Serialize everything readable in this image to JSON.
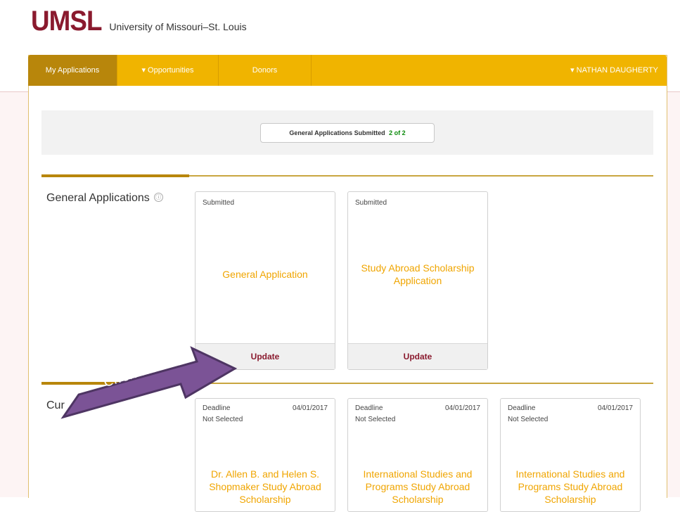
{
  "logo": {
    "mark": "UMSL",
    "text": "University of Missouri–St. Louis"
  },
  "nav": {
    "items": [
      {
        "label": "My Applications"
      },
      {
        "label": "▾ Opportunities"
      },
      {
        "label": "Donors"
      }
    ],
    "user": "▾ NATHAN DAUGHERTY"
  },
  "summary": {
    "label": "General Applications Submitted",
    "count": "2 of 2"
  },
  "general": {
    "title": "General Applications",
    "info_icon": "ⓘ",
    "cards": [
      {
        "status": "Submitted",
        "title": "General Application",
        "action": "Update"
      },
      {
        "status": "Submitted",
        "title": "Study Abroad Scholarship Application",
        "action": "Update"
      }
    ]
  },
  "current": {
    "title_partial": "Cur",
    "cards": [
      {
        "deadline_label": "Deadline",
        "date": "04/01/2017",
        "selection": "Not Selected",
        "title": "Dr. Allen B. and Helen S. Shopmaker Study Abroad Scholarship"
      },
      {
        "deadline_label": "Deadline",
        "date": "04/01/2017",
        "selection": "Not Selected",
        "title": "International Studies and Programs Study Abroad Scholarship"
      },
      {
        "deadline_label": "Deadline",
        "date": "04/01/2017",
        "selection": "Not Selected",
        "title": "International Studies and Programs Study Abroad Scholarship"
      }
    ]
  },
  "callout": {
    "text": "Click here"
  },
  "colors": {
    "brand": "#8a1a2e",
    "gold": "#f0b400",
    "arrow": "#7b5396"
  }
}
